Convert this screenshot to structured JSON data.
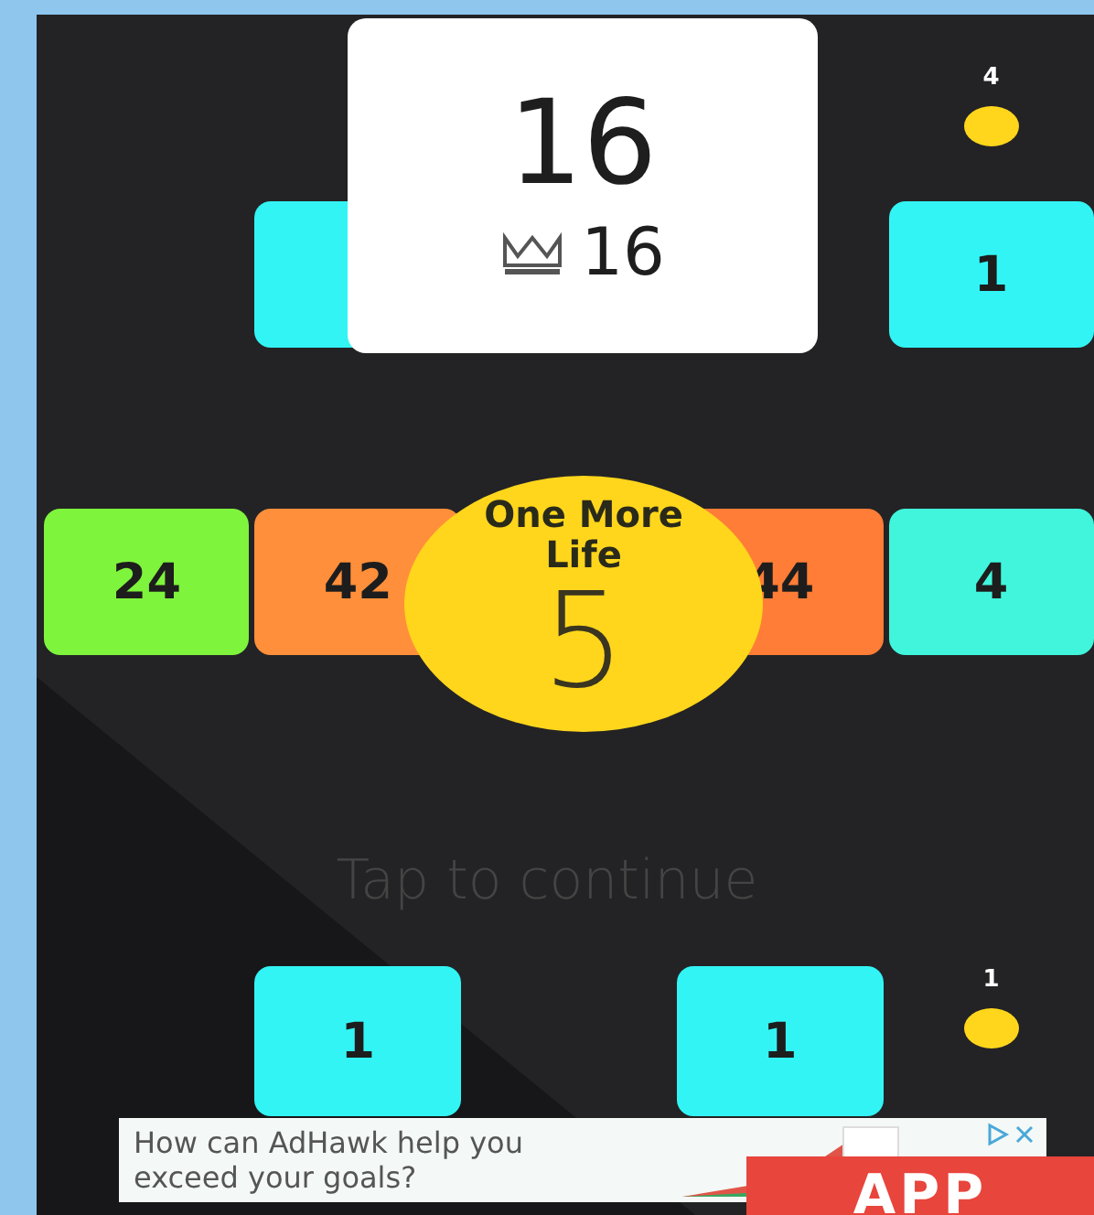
{
  "score_card": {
    "score": "16",
    "best": "16"
  },
  "rows": [
    {
      "cells": [
        {
          "kind": "empty"
        },
        {
          "kind": "empty"
        },
        {
          "kind": "empty"
        },
        {
          "kind": "empty"
        },
        {
          "kind": "coin",
          "label": "4"
        }
      ]
    },
    {
      "cells": [
        {
          "kind": "empty"
        },
        {
          "kind": "block",
          "color": "#33f4f4"
        },
        {
          "kind": "empty"
        },
        {
          "kind": "empty"
        },
        {
          "kind": "block",
          "color": "#33f4f4",
          "label": "1"
        }
      ]
    },
    {
      "cells": [
        {
          "kind": "block",
          "color": "#7ef43c",
          "label": "24"
        },
        {
          "kind": "block",
          "color": "#ff8f3a",
          "label": "42"
        },
        {
          "kind": "empty"
        },
        {
          "kind": "block",
          "color": "#ff7d36",
          "label": "44"
        },
        {
          "kind": "block",
          "color": "#40f5dc",
          "label": "4"
        }
      ]
    },
    {
      "cells": [
        {
          "kind": "empty"
        },
        {
          "kind": "block",
          "color": "#33f4f4",
          "label": "1"
        },
        {
          "kind": "empty"
        },
        {
          "kind": "block",
          "color": "#33f4f4",
          "label": "1"
        },
        {
          "kind": "coin",
          "label": "1"
        }
      ]
    }
  ],
  "life_prompt": {
    "title": "One More Life",
    "countdown": "5"
  },
  "hint": "Tap to continue",
  "ad": {
    "text": "How can AdHawk help you exceed your goals?",
    "badge": "APP"
  }
}
